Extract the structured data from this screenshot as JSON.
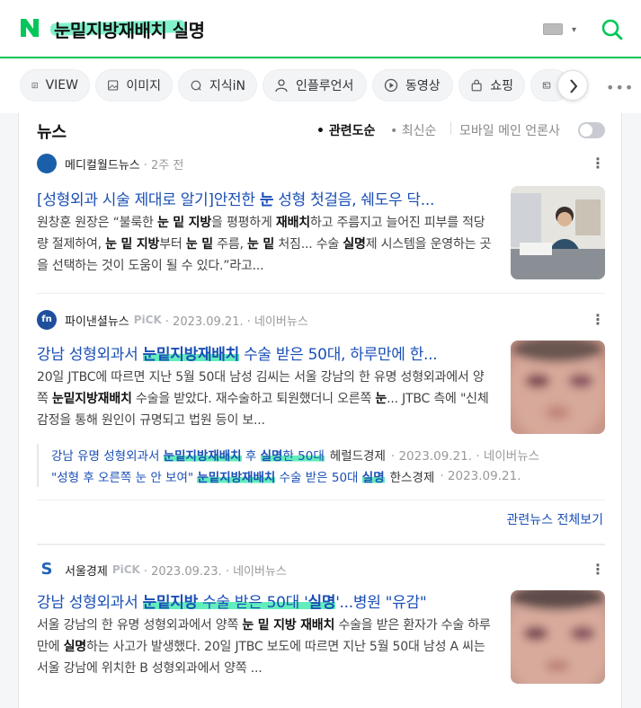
{
  "search": {
    "query": "눈밑지방재배치 실명"
  },
  "header": {
    "logo_letter": "N",
    "brand_color": "#03c75a",
    "keyboard_caret": "▾"
  },
  "tabs": [
    {
      "label": "VIEW",
      "icon": "view-icon"
    },
    {
      "label": "이미지",
      "icon": "image-icon"
    },
    {
      "label": "지식iN",
      "icon": "qna-icon"
    },
    {
      "label": "인플루언서",
      "icon": "person-icon"
    },
    {
      "label": "동영상",
      "icon": "play-icon"
    },
    {
      "label": "쇼핑",
      "icon": "bag-icon"
    },
    {
      "label": "",
      "icon": "news-icon"
    }
  ],
  "news": {
    "section_title": "뉴스",
    "sort_relevance": "관련도순",
    "sort_latest": "최신순",
    "mobile_main_label": "모바일 메인 언론사",
    "more_dots": "⋮",
    "items": [
      {
        "press": "메디컬월드뉴스",
        "meta": "· 2주 전",
        "title_pre": "[성형외과 시술 제대로 알기]안전한 ",
        "title_bold": "눈",
        "title_post": " 성형 첫걸음, 쉐도우 닥...",
        "desc_parts": [
          [
            "원창훈 원장은 “불룩한 ",
            0
          ],
          [
            "눈 밑 지방",
            1
          ],
          [
            "을 평평하게 ",
            0
          ],
          [
            "재배치",
            1
          ],
          [
            "하고 주름지고 늘어진 피부를 적당량 절제하여, ",
            0
          ],
          [
            "눈 밑 지방",
            1
          ],
          [
            "부터 ",
            0
          ],
          [
            "눈 밑",
            1
          ],
          [
            " 주름, ",
            0
          ],
          [
            "눈 밑",
            1
          ],
          [
            " 처짐... 수술 ",
            0
          ],
          [
            "실명",
            1
          ],
          [
            "제 시스템을 운영하는 곳을 선택하는 것이 도움이 될 수 있다.”라고...",
            0
          ]
        ]
      },
      {
        "press": "파이낸셜뉴스",
        "pick": "PiCK",
        "meta": "· 2023.09.21. · 네이버뉴스",
        "title_pre": "강남 성형외과서 ",
        "title_bold": "눈밑지방재배치",
        "title_post": " 수술 받은 50대, 하루만에 한...",
        "desc_parts": [
          [
            "20일 JTBC에 따르면 지난 5월 50대 남성 김씨는 서울 강남의 한 유명 성형외과에서 양쪽 ",
            0
          ],
          [
            "눈밑지방재배치",
            1
          ],
          [
            " 수술을 받았다. 재수술하고 퇴원했더니 오른쪽 ",
            0
          ],
          [
            "눈",
            1
          ],
          [
            "... JTBC 측에 \"신체 감정을 통해 원인이 규명되고 법원 등이 보...",
            0
          ]
        ],
        "related": [
          {
            "pre": "강남 유명 성형외과서 ",
            "bold": "눈밑지방재배치",
            "mid": " 후 ",
            "bold2": "실명",
            "post": "한 50대",
            "press": "헤럴드경제",
            "meta": "· 2023.09.21. · 네이버뉴스"
          },
          {
            "pre": "\"성형 후 오른쪽 눈 안 보여\" ",
            "bold": "눈밑지방재배치",
            "mid": " 수술 받은 50대 ",
            "bold2": "실명",
            "post": "",
            "press": "한스경제",
            "meta": "· 2023.09.21."
          }
        ],
        "all_related": "관련뉴스 전체보기"
      },
      {
        "press": "서울경제",
        "pick": "PiCK",
        "meta": "· 2023.09.23. · 네이버뉴스",
        "title_pre": "강남 성형외과서 ",
        "title_bold": "눈밑지방",
        "title_mid": " 수술 받은 50대 '",
        "title_bold2": "실명",
        "title_post": "'...병원 \"유감\"",
        "desc_parts": [
          [
            "서울 강남의 한 유명 성형외과에서 양쪽 ",
            0
          ],
          [
            "눈 밑 지방 재배치",
            1
          ],
          [
            " 수술을 받은 환자가 수술 하루 만에 ",
            0
          ],
          [
            "실명",
            1
          ],
          [
            "하는 사고가 발생했다. 20일 JTBC 보도에 따르면 지난 5월 50대 남성 A 씨는 서울 강남에 위치한 B 성형외과에서 양쪽 ...",
            0
          ]
        ]
      }
    ]
  },
  "colors": {
    "title_link": "#1a4fb5",
    "highlight": "#1ee5a0"
  }
}
